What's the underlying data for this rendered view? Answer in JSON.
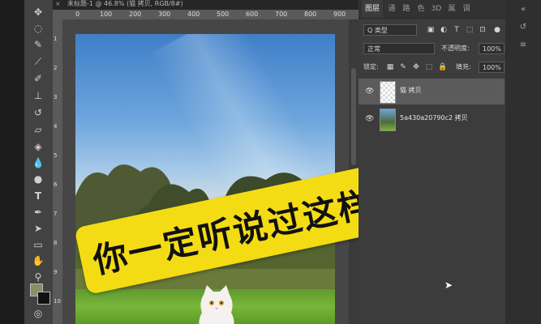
{
  "document_tab": {
    "close": "×",
    "title": "未标题-1 @ 46.8% (猫 拷贝, RGB/8#)"
  },
  "ruler_top": [
    "0",
    "100",
    "200",
    "300",
    "400",
    "500",
    "600",
    "700",
    "800",
    "900"
  ],
  "ruler_left": [
    "1",
    "2",
    "3",
    "4",
    "5",
    "6",
    "7",
    "8",
    "9",
    "10"
  ],
  "caption": "你一定听说过这样融图",
  "panel": {
    "tabs": [
      {
        "label": "图层",
        "active": true
      },
      {
        "label": "通",
        "active": false
      },
      {
        "label": "路",
        "active": false
      },
      {
        "label": "色",
        "active": false
      },
      {
        "label": "3D",
        "active": false
      },
      {
        "label": "属",
        "active": false
      },
      {
        "label": "调",
        "active": false
      }
    ],
    "filter_label": "Q 类型",
    "blend_mode": "正常",
    "opacity_label": "不透明度:",
    "opacity_value": "100%",
    "lock_label": "锁定:",
    "fill_label": "填充:",
    "fill_value": "100%",
    "layers": [
      {
        "name": "猫 拷贝",
        "selected": true
      },
      {
        "name": "5a430a20790c2 拷贝",
        "selected": false
      }
    ]
  },
  "tools": [
    "move-icon",
    "lasso-icon",
    "quick-select-icon",
    "eyedropper-icon",
    "brush-icon",
    "clone-stamp-icon",
    "history-brush-icon",
    "eraser-icon",
    "paint-bucket-icon",
    "blur-icon",
    "dodge-icon",
    "text-icon",
    "pen-icon",
    "path-select-icon",
    "rectangle-icon",
    "hand-icon",
    "zoom-icon"
  ],
  "colors": {
    "foreground": "#8a8f66",
    "background": "#111111",
    "caption_bg": "#f4dc14"
  }
}
